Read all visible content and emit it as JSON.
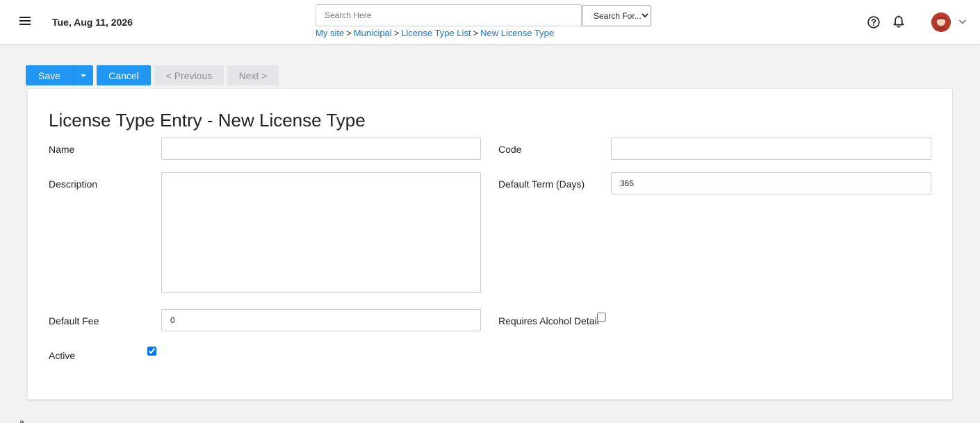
{
  "header": {
    "date": "Tue, Aug 11, 2026",
    "search": {
      "placeholder": "Search Here",
      "value": ""
    },
    "search_for": {
      "selected": "Search For..."
    },
    "breadcrumb": {
      "items": [
        "My site",
        "Municipal",
        "License Type List",
        "New License Type"
      ],
      "separator": ">"
    },
    "icons": {
      "menu": "hamburger-menu-icon",
      "help": "help-circle-icon",
      "notifications": "bell-icon",
      "avatar": "user-avatar",
      "avatar_menu": "chevron-down-icon"
    }
  },
  "toolbar": {
    "save_label": "Save",
    "cancel_label": "Cancel",
    "previous_label": "< Previous",
    "next_label": "Next >"
  },
  "form": {
    "title": "License Type Entry - New License Type",
    "name": {
      "label": "Name",
      "value": ""
    },
    "code": {
      "label": "Code",
      "value": ""
    },
    "description": {
      "label": "Description",
      "value": ""
    },
    "default_term": {
      "label": "Default Term (Days)",
      "value": "365"
    },
    "default_fee": {
      "label": "Default Fee",
      "value": "0"
    },
    "requires_alcohol": {
      "label": "Requires Alcohol Detail",
      "checked": false
    },
    "active": {
      "label": "Active",
      "checked": true
    }
  },
  "footer": {
    "stray_text": "a"
  },
  "colors": {
    "accent": "#2196f3",
    "link": "#1a73c8",
    "disabled_bg": "#e3e5e8",
    "disabled_text": "#8a8f96",
    "page_bg": "#f2f2f2"
  }
}
